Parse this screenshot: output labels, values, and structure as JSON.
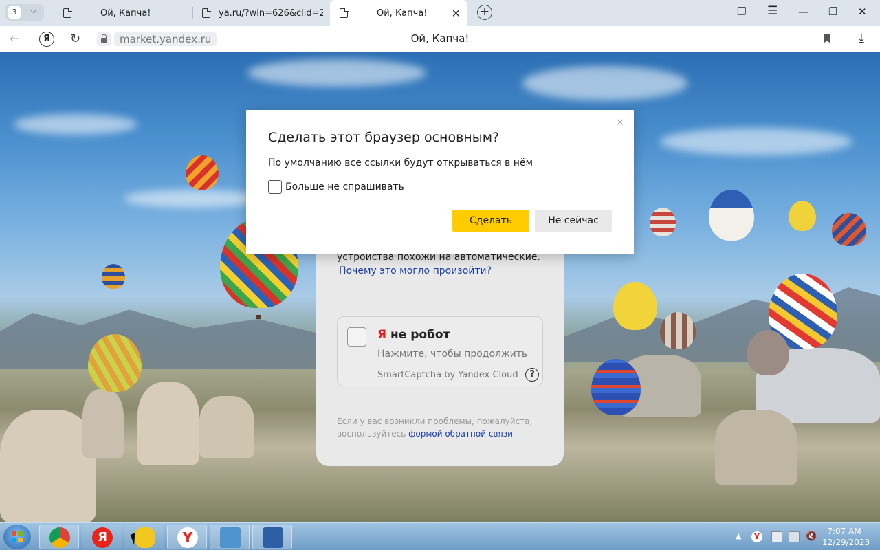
{
  "browser": {
    "tab_count": "3",
    "tabs": [
      {
        "title": "Ой, Капча!",
        "active": false
      },
      {
        "title": "ya.ru/?win=626&clid=2335",
        "active": false
      },
      {
        "title": "Ой, Капча!",
        "active": true
      }
    ],
    "url_domain": "market.yandex.ru",
    "page_title": "Ой, Капча!"
  },
  "captcha": {
    "partial_text": "устройства похожи на автоматические.",
    "why_link": "Почему это могло произойти?",
    "robot_prefix": "Я",
    "robot_label": " не робот",
    "robot_sub": "Нажмите, чтобы продолжить",
    "robot_brand": "SmartCaptcha by Yandex Cloud",
    "help_glyph": "?",
    "footer_text": "Если у вас возникли проблемы, пожалуйста, воспользуйтесь",
    "footer_link": "формой обратной связи"
  },
  "dialog": {
    "title": "Сделать этот браузер основным?",
    "text": "По умолчанию все ссылки будут открываться в нём",
    "checkbox_label": "Больше не спрашивать",
    "checkbox_checked": false,
    "primary_button": "Сделать",
    "secondary_button": "Не сейчас",
    "close_glyph": "×"
  },
  "taskbar": {
    "apps": [
      "chrome-icon",
      "yandex-icon",
      "taskbar-app-icon",
      "yandex-browser-icon",
      "control-panel-icon",
      "virtualbox-icon"
    ],
    "clock_time": "7:07 AM",
    "clock_date": "12/29/2023"
  },
  "colors": {
    "accent_yellow": "#ffcc00",
    "link_blue": "#1a3fa6",
    "yandex_red": "#e01e1e"
  }
}
